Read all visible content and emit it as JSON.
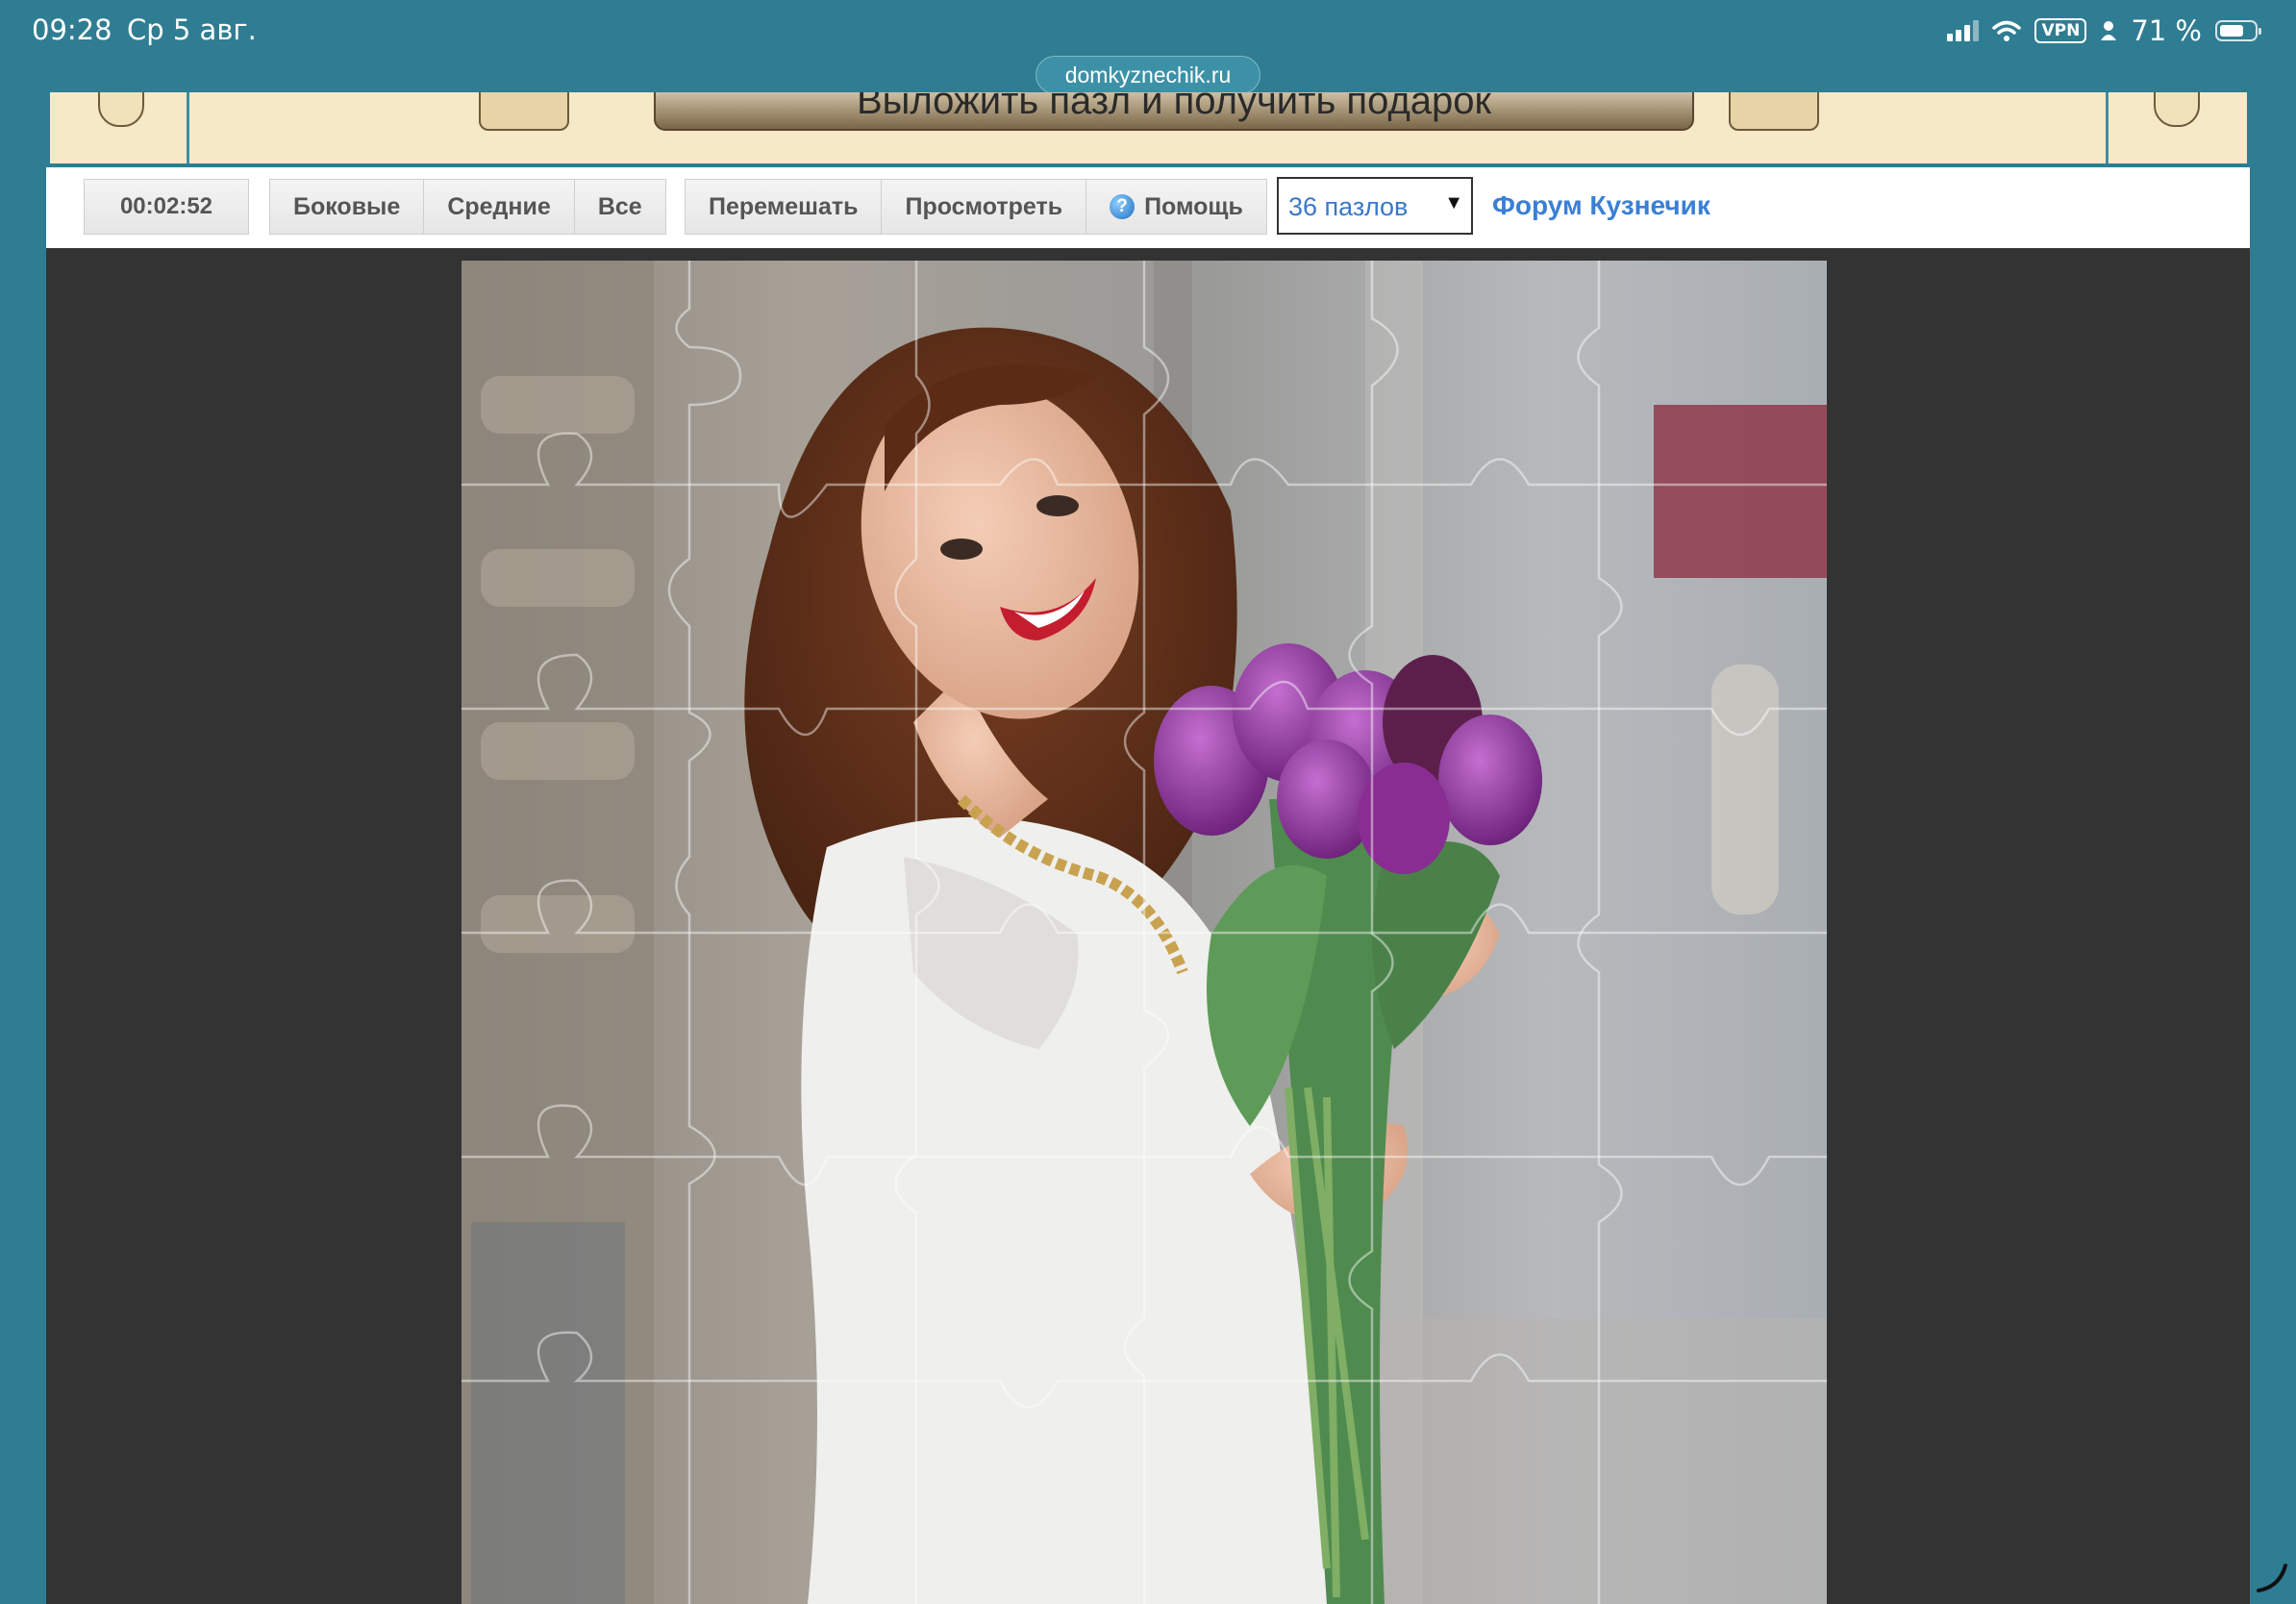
{
  "status_bar": {
    "time": "09:28",
    "date": "Ср 5 авг.",
    "vpn": "VPN",
    "battery_text": "71 %",
    "battery_level": 0.71
  },
  "browser": {
    "url": "domkyznechik.ru"
  },
  "banner": {
    "text": "Выложить пазл и получить подарок"
  },
  "toolbar": {
    "timer": "00:02:52",
    "filter_buttons": [
      "Боковые",
      "Средние",
      "Все"
    ],
    "shuffle": "Перемешать",
    "preview": "Просмотреть",
    "help": "Помощь",
    "pieces_select": "36 пазлов",
    "forum_link": "Форум Кузнечик"
  },
  "puzzle": {
    "image_subject": "woman holding purple tulips",
    "grid": {
      "cols": 6,
      "rows": 6
    }
  },
  "colors": {
    "frame": "#2f7d92",
    "board": "#333333",
    "link": "#3a7fd4",
    "banner": "#f5e9c7"
  }
}
